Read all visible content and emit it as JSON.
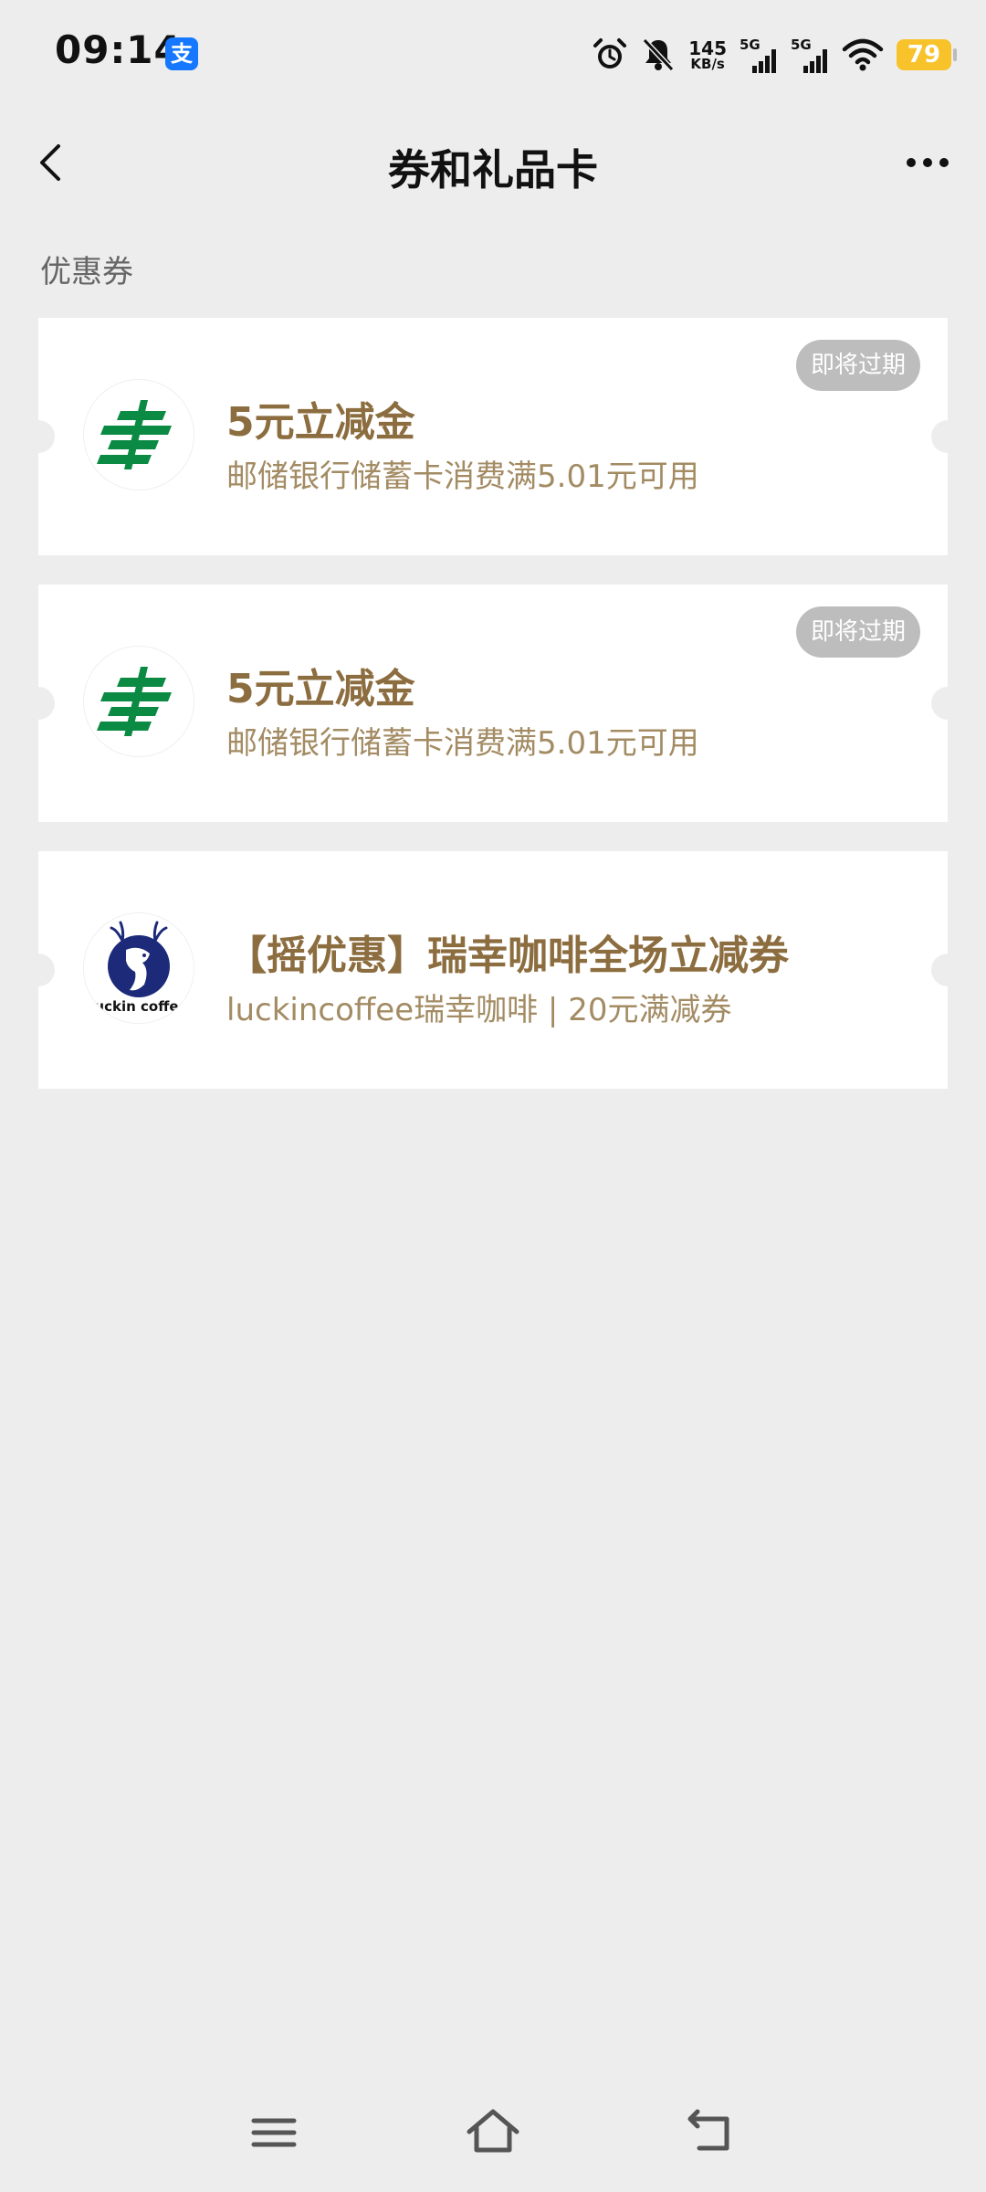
{
  "status_bar": {
    "time": "09:14",
    "app_badge": "支",
    "net_speed_value": "145",
    "net_speed_unit": "KB/s",
    "signal_1_label": "5G",
    "signal_2_label": "5G",
    "battery_level": "79",
    "icons": [
      "alarm-icon",
      "mute-icon",
      "signal-icon",
      "wifi-icon",
      "battery-icon"
    ]
  },
  "header": {
    "title": "券和礼品卡",
    "icons": [
      "back-arrow-icon",
      "more-icon"
    ]
  },
  "section": {
    "label": "优惠券"
  },
  "coupons": [
    {
      "title": "5元立减金",
      "description": "邮储银行储蓄卡消费满5.01元可用",
      "tag": "即将过期",
      "logo": "postal-savings-logo",
      "logo_color": "#0b8a43"
    },
    {
      "title": "5元立减金",
      "description": "邮储银行储蓄卡消费满5.01元可用",
      "tag": "即将过期",
      "logo": "postal-savings-logo",
      "logo_color": "#0b8a43"
    },
    {
      "title": "【摇优惠】瑞幸咖啡全场立减券",
      "description": "luckincoffee瑞幸咖啡 | 20元满减券",
      "logo": "luckin-coffee-logo",
      "logo_text": "luckin coffee",
      "logo_color": "#1d2a7a"
    }
  ],
  "nav_bar": {
    "icons": [
      "menu-icon",
      "home-icon",
      "back-icon"
    ]
  },
  "colors": {
    "background": "#ededed",
    "coupon_title": "#8c6d3f",
    "coupon_desc": "#a38b63",
    "tag_bg": "#bdbdbd",
    "battery": "#f7c22a",
    "app_badge": "#1677ff"
  }
}
